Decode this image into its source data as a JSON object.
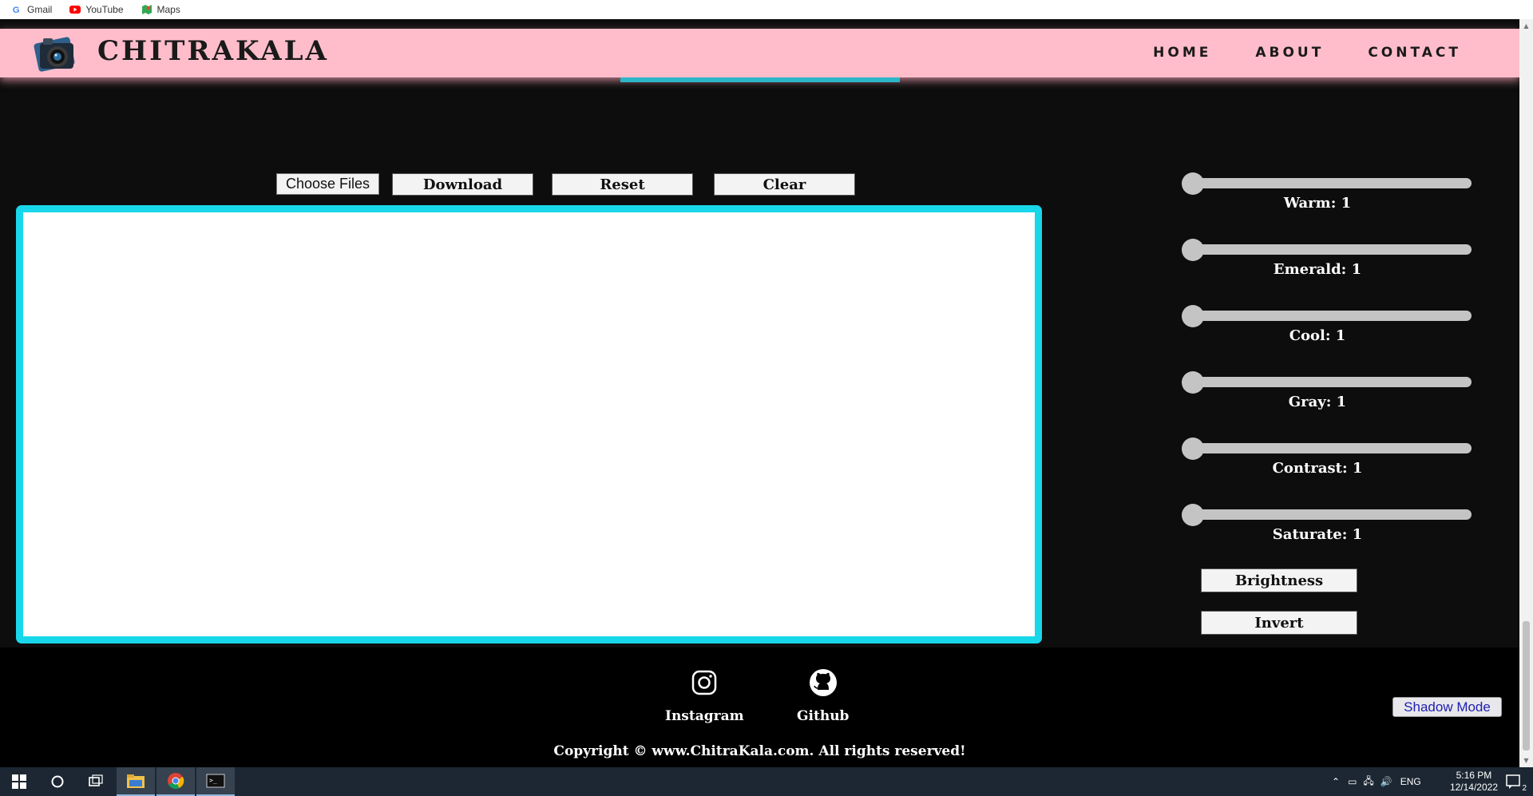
{
  "bookmarks": [
    {
      "label": "Gmail",
      "icon": "gmail-icon"
    },
    {
      "label": "YouTube",
      "icon": "youtube-icon"
    },
    {
      "label": "Maps",
      "icon": "maps-icon"
    }
  ],
  "header": {
    "brand": "CHITRAKALA",
    "nav": [
      "HOME",
      "ABOUT",
      "CONTACT"
    ]
  },
  "controls": {
    "file_label": "Choose Files",
    "download": "Download",
    "reset": "Reset",
    "clear": "Clear"
  },
  "sliders": [
    {
      "label": "Warm: 1",
      "value": 1
    },
    {
      "label": "Emerald: 1",
      "value": 1
    },
    {
      "label": "Cool: 1",
      "value": 1
    },
    {
      "label": "Gray: 1",
      "value": 1
    },
    {
      "label": "Contrast: 1",
      "value": 1
    },
    {
      "label": "Saturate: 1",
      "value": 1
    }
  ],
  "side_buttons": {
    "brightness": "Brightness",
    "invert": "Invert"
  },
  "footer": {
    "instagram": "Instagram",
    "github": "Github",
    "copyright": "Copyright © www.ChitraKala.com. All rights reserved!",
    "shadow_mode": "Shadow Mode"
  },
  "taskbar": {
    "language": "ENG",
    "time": "5:16 PM",
    "date": "12/14/2022",
    "notifications": "2"
  },
  "colors": {
    "header_bg": "#ffbdcb",
    "canvas_border": "#19d7ea",
    "page_bg": "#0d0d0d"
  }
}
